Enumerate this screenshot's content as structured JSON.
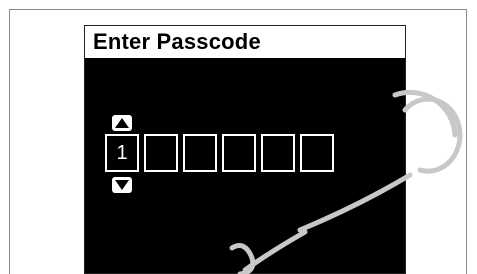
{
  "screen": {
    "title": "Enter Passcode"
  },
  "passcode": {
    "digits": [
      "1",
      "",
      "",
      "",
      "",
      ""
    ],
    "active_index": 0
  },
  "controls": {
    "up_icon": "triangle-up-icon",
    "down_icon": "triangle-down-icon"
  },
  "colors": {
    "screen_background": "#000000",
    "title_background": "#ffffff",
    "digit_border": "#ffffff",
    "watermark": "#c8c8c8"
  }
}
